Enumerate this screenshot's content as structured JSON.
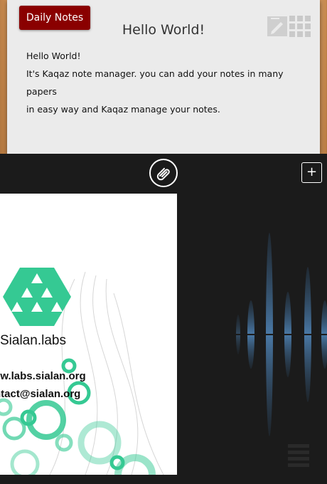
{
  "paper": {
    "label": "Daily Notes",
    "title": "Hello World!",
    "body": [
      "Hello World!",
      "It's Kaqaz note manager. you can add your notes in many papers",
      "in easy way and Kaqaz manage your notes."
    ]
  },
  "toolbar": {
    "add_label": "+",
    "attach_icon": "paperclip-icon"
  },
  "image_card": {
    "brand": "Sialan.labs",
    "contact_lines": [
      "vw.labs.sialan.org",
      "ntact@sialan.org"
    ]
  },
  "colors": {
    "label_bg": "#8a0000",
    "paper_bg": "#ebebeb",
    "overlay_bg": "#1b1b1b",
    "logo_green": "#35c993",
    "wave_blue": "#4a79a6"
  }
}
